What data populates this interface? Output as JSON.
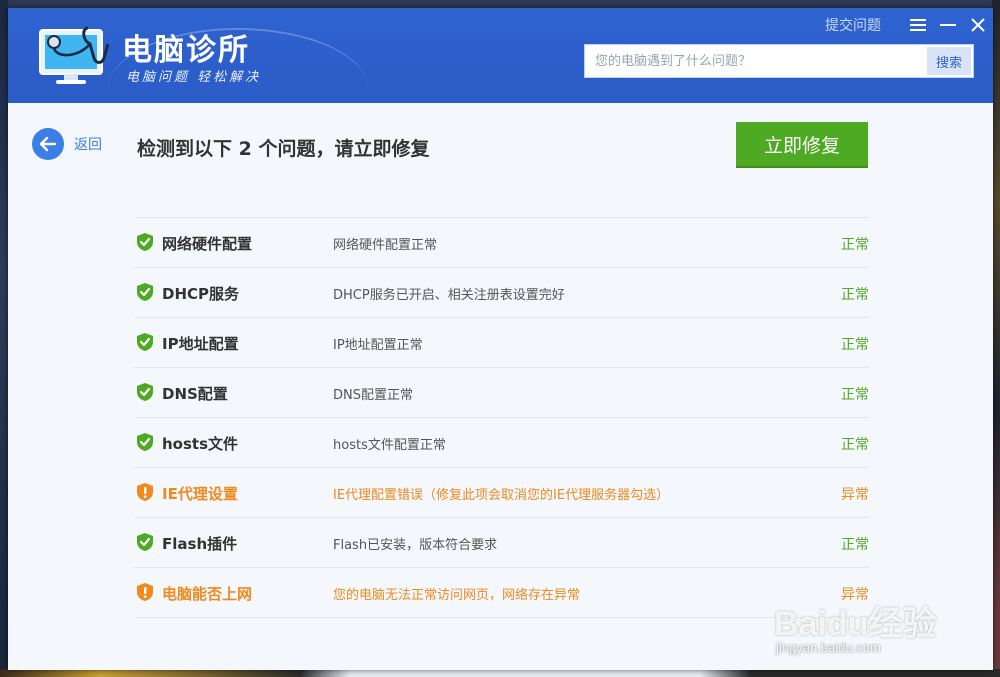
{
  "app": {
    "title": "电脑诊所",
    "subtitle": "电脑问题 轻松解决",
    "submit_issue": "提交问题",
    "search_placeholder": "您的电脑遇到了什么问题？",
    "search_button": "搜索"
  },
  "nav": {
    "back_label": "返回"
  },
  "summary": {
    "headline": "检测到以下 2 个问题，请立即修复",
    "fix_button": "立即修复"
  },
  "checks": [
    {
      "name": "网络硬件配置",
      "desc": "网络硬件配置正常",
      "status": "正常",
      "ok": true
    },
    {
      "name": "DHCP服务",
      "desc": "DHCP服务已开启、相关注册表设置完好",
      "status": "正常",
      "ok": true
    },
    {
      "name": "IP地址配置",
      "desc": "IP地址配置正常",
      "status": "正常",
      "ok": true
    },
    {
      "name": "DNS配置",
      "desc": "DNS配置正常",
      "status": "正常",
      "ok": true
    },
    {
      "name": "hosts文件",
      "desc": "hosts文件配置正常",
      "status": "正常",
      "ok": true
    },
    {
      "name": "IE代理设置",
      "desc": "IE代理配置错误（修复此项会取消您的IE代理服务器勾选）",
      "status": "异常",
      "ok": false
    },
    {
      "name": "Flash插件",
      "desc": "Flash已安装，版本符合要求",
      "status": "正常",
      "ok": true
    },
    {
      "name": "电脑能否上网",
      "desc": "您的电脑无法正常访问网页，网络存在异常",
      "status": "异常",
      "ok": false
    }
  ],
  "watermark": {
    "brand": "Baidu经验",
    "url": "jingyan.baidu.com"
  },
  "colors": {
    "header": "#2f63d0",
    "ok": "#4eaa23",
    "warn": "#ef8a1e",
    "fix_button": "#4eaa23"
  }
}
